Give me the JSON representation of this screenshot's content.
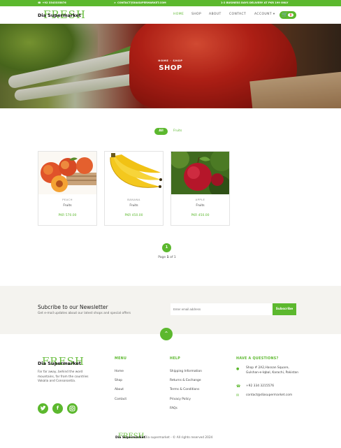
{
  "topbar": {
    "phone": "+92 3343335876",
    "email": "CONTACT@DIASUPERMARKET.COM",
    "delivery": "1-2 BUSINESS DAYS DELIVERY AT PKR 199 ONLY"
  },
  "header": {
    "logo_script": "FRESH",
    "logo_text": "Dia Supermarket",
    "nav": [
      "HOME",
      "SHOP",
      "ABOUT",
      "CONTACT",
      "ACCOUNT ▾"
    ],
    "cart_count": "0"
  },
  "hero": {
    "breadcrumb": "HOME  ·  SHOP",
    "title": "SHOP"
  },
  "filters": {
    "all": "All",
    "fruits": "Fruits"
  },
  "products": [
    {
      "name": "PEACH",
      "category": "Fruits",
      "price": "PKR 570.00",
      "image": "peach"
    },
    {
      "name": "BANANA",
      "category": "Fruits",
      "price": "PKR 450.00",
      "image": "banana"
    },
    {
      "name": "APPLE",
      "category": "Fruits",
      "price": "PKR 450.00",
      "image": "apple"
    }
  ],
  "pagination": {
    "current": "1",
    "info_prefix": "Page ",
    "info_current": "1",
    "info_of": " of ",
    "info_total": "1"
  },
  "newsletter": {
    "heading": "Subcribe to our Newsletter",
    "subtext": "Get e-mail updates about our latest shops and special offers",
    "placeholder": "Enter email address",
    "button": "Subscribe"
  },
  "footer": {
    "logo_script": "FRESH",
    "logo_text": "Dia Supermarket",
    "description": "Far far away, behind the word mountains, far from the countries Vokalia and Consonantia.",
    "social": [
      "twitter-icon",
      "facebook-icon",
      "instagram-icon"
    ],
    "menu_heading": "MENU",
    "menu": [
      "Home",
      "Shop",
      "About",
      "Contact"
    ],
    "help_heading": "HELP",
    "help": [
      "Shipping Information",
      "Returns & Exchange",
      "Terms & Conditions",
      "Privacy Policy",
      "FAQs"
    ],
    "contact_heading": "HAVE A QUESTIONS?",
    "address": "Shop # 2A2,Hassan Square, Gulshan-e-Iqbal, Karachi, Pakistan",
    "phone": "+92 334 3215576",
    "email": "contact@diasupermarket.com",
    "copyright_logo": "Dia Supermarket",
    "copyright": "Dia supermarket - © All rights reserved 2024"
  },
  "colors": {
    "accent": "#5cb82e",
    "newsletter_bg": "#f4f3ef"
  }
}
